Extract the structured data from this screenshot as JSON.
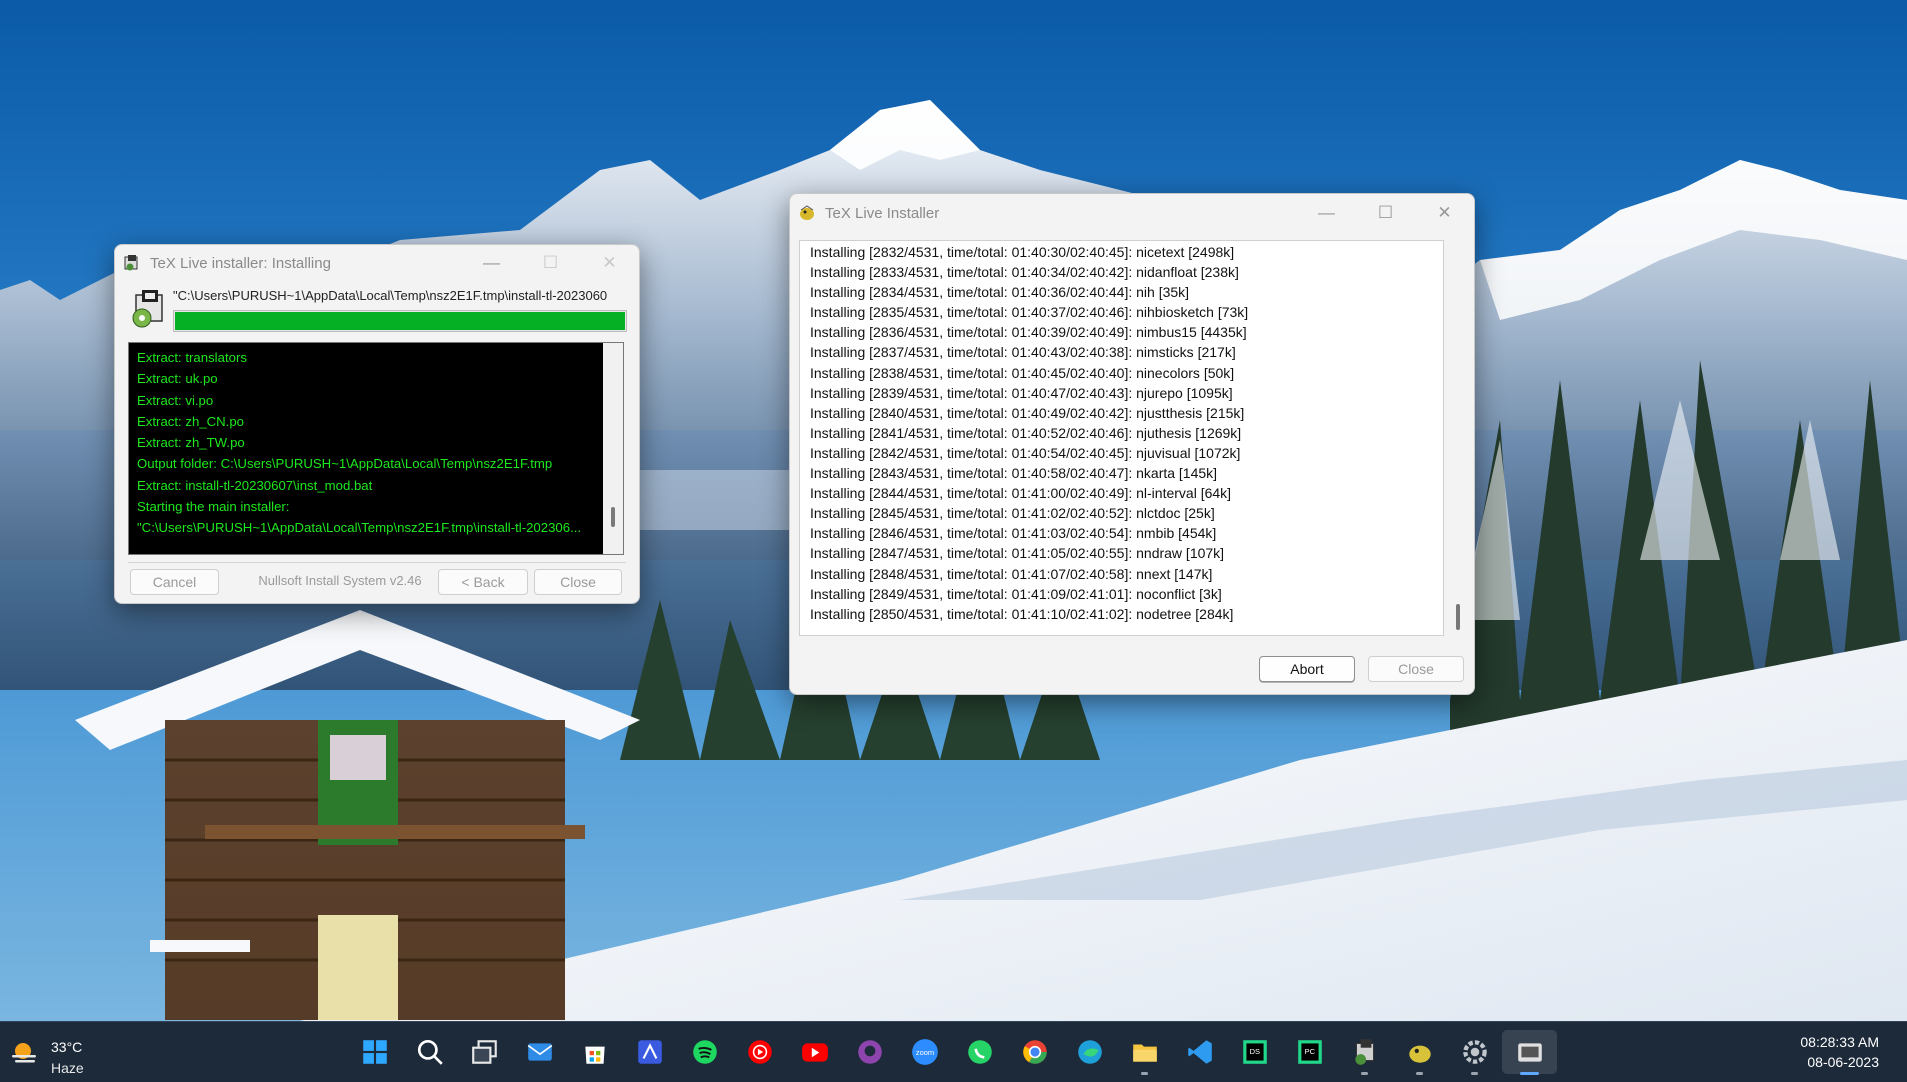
{
  "nsis_window": {
    "title": "TeX Live installer: Installing",
    "path_text": "\"C:\\Users\\PURUSH~1\\AppData\\Local\\Temp\\nsz2E1F.tmp\\install-tl-2023060",
    "progress": 1.0,
    "log_lines": [
      "Extract: translators",
      "Extract: uk.po",
      "Extract: vi.po",
      "Extract: zh_CN.po",
      "Extract: zh_TW.po",
      "Output folder: C:\\Users\\PURUSH~1\\AppData\\Local\\Temp\\nsz2E1F.tmp",
      "Extract: install-tl-20230607\\inst_mod.bat",
      "Starting the main installer:",
      "\"C:\\Users\\PURUSH~1\\AppData\\Local\\Temp\\nsz2E1F.tmp\\install-tl-202306..."
    ],
    "cancel_label": "Cancel",
    "branding": "Nullsoft Install System v2.46",
    "back_label": "< Back",
    "close_label": "Close"
  },
  "tl_window": {
    "title": "TeX Live Installer",
    "log_lines": [
      "Installing [2832/4531, time/total: 01:40:30/02:40:45]: nicetext [2498k]",
      "Installing [2833/4531, time/total: 01:40:34/02:40:42]: nidanfloat [238k]",
      "Installing [2834/4531, time/total: 01:40:36/02:40:44]: nih [35k]",
      "Installing [2835/4531, time/total: 01:40:37/02:40:46]: nihbiosketch [73k]",
      "Installing [2836/4531, time/total: 01:40:39/02:40:49]: nimbus15 [4435k]",
      "Installing [2837/4531, time/total: 01:40:43/02:40:38]: nimsticks [217k]",
      "Installing [2838/4531, time/total: 01:40:45/02:40:40]: ninecolors [50k]",
      "Installing [2839/4531, time/total: 01:40:47/02:40:43]: njurepo [1095k]",
      "Installing [2840/4531, time/total: 01:40:49/02:40:42]: njustthesis [215k]",
      "Installing [2841/4531, time/total: 01:40:52/02:40:46]: njuthesis [1269k]",
      "Installing [2842/4531, time/total: 01:40:54/02:40:45]: njuvisual [1072k]",
      "Installing [2843/4531, time/total: 01:40:58/02:40:47]: nkarta [145k]",
      "Installing [2844/4531, time/total: 01:41:00/02:40:49]: nl-interval [64k]",
      "Installing [2845/4531, time/total: 01:41:02/02:40:52]: nlctdoc [25k]",
      "Installing [2846/4531, time/total: 01:41:03/02:40:54]: nmbib [454k]",
      "Installing [2847/4531, time/total: 01:41:05/02:40:55]: nndraw [107k]",
      "Installing [2848/4531, time/total: 01:41:07/02:40:58]: nnext [147k]",
      "Installing [2849/4531, time/total: 01:41:09/02:41:01]: noconflict [3k]",
      "Installing [2850/4531, time/total: 01:41:10/02:41:02]: nodetree [284k]"
    ],
    "abort_label": "Abort",
    "close_label": "Close"
  },
  "taskbar": {
    "weather_temp": "33°C",
    "weather_cond": "Haze",
    "time": "08:28:33 AM",
    "date": "08-06-2023",
    "icons": [
      {
        "name": "start-icon",
        "color": "#2ea8ff"
      },
      {
        "name": "search-icon",
        "color": "#ffffff"
      },
      {
        "name": "task-view-icon",
        "color": "#e8e8e8"
      },
      {
        "name": "mail-icon",
        "color": "#2f8ce6"
      },
      {
        "name": "microsoft-store-icon",
        "color": "#ffffff"
      },
      {
        "name": "whiteboard-icon",
        "color": "#3a5be0"
      },
      {
        "name": "spotify-icon",
        "color": "#1ed760"
      },
      {
        "name": "youtube-music-icon",
        "color": "#ff0000"
      },
      {
        "name": "youtube-icon",
        "color": "#ff0000"
      },
      {
        "name": "github-icon",
        "color": "#8e44ad"
      },
      {
        "name": "zoom-icon",
        "color": "#2d8cff"
      },
      {
        "name": "whatsapp-icon",
        "color": "#25d366"
      },
      {
        "name": "chrome-icon",
        "color": "#ea4335"
      },
      {
        "name": "edge-icon",
        "color": "#1fa0d8"
      },
      {
        "name": "file-explorer-icon",
        "color": "#f5c542"
      },
      {
        "name": "vscode-icon",
        "color": "#2f9bf0"
      },
      {
        "name": "dataspell-icon",
        "color": "#21d789"
      },
      {
        "name": "pycharm-icon",
        "color": "#21d789"
      },
      {
        "name": "tex-installer-icon",
        "color": "#d0d0d0"
      },
      {
        "name": "tex-live-icon",
        "color": "#d8c23a"
      },
      {
        "name": "settings-icon",
        "color": "#c0c6cc"
      },
      {
        "name": "camera-app-icon",
        "color": "#e0e0e0"
      }
    ]
  }
}
